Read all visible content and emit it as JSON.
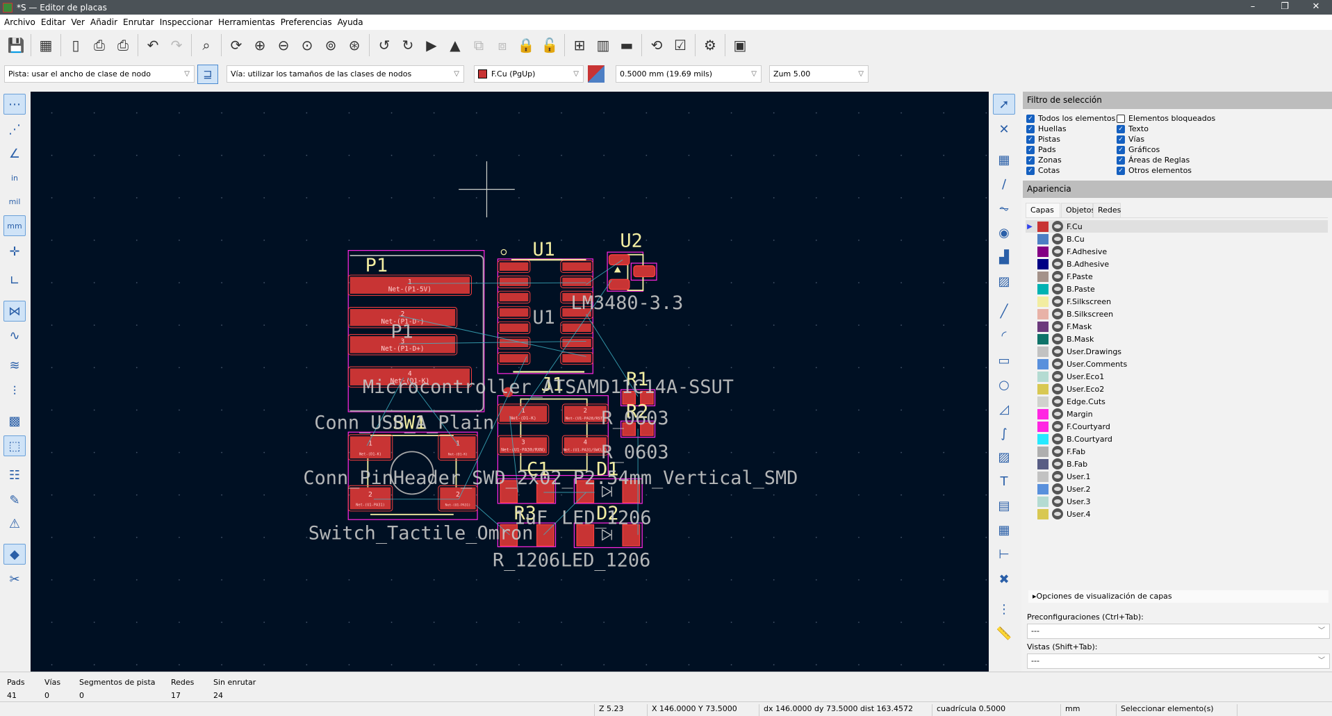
{
  "window": {
    "title": "*S — Editor de placas",
    "controls": [
      "–",
      "❐",
      "✕"
    ]
  },
  "menu": [
    "Archivo",
    "Editar",
    "Ver",
    "Añadir",
    "Enrutar",
    "Inspeccionar",
    "Herramientas",
    "Preferencias",
    "Ayuda"
  ],
  "toolbar_top": [
    [
      "save-icon"
    ],
    [
      "board-setup-icon"
    ],
    [
      "page-settings-icon",
      "print-icon",
      "plot-icon"
    ],
    [
      "undo-icon",
      "redo-icon"
    ],
    [
      "find-icon"
    ],
    [
      "refresh-icon",
      "zoom-in-icon",
      "zoom-out-icon",
      "zoom-fit-icon",
      "zoom-objects-icon",
      "zoom-selection-icon"
    ],
    [
      "rotate-ccw-icon",
      "rotate-cw-icon",
      "flip-icon",
      "mirror-icon",
      "group-icon",
      "ungroup-icon",
      "lock-icon",
      "unlock-icon"
    ],
    [
      "netlist-icon",
      "footprint-library-icon",
      "footprint-editor-icon"
    ],
    [
      "update-pcb-icon",
      "drc-icon"
    ],
    [
      "scripting-icon"
    ],
    [
      "console-icon"
    ]
  ],
  "toolbar_options": {
    "track_width": "Pista: usar el ancho de clase de nodo",
    "via_size": "Vía: utilizar los tamaños de las clases de nodos",
    "layer": "F.Cu (PgUp)",
    "layer_color": "#c83434",
    "grid": "0.5000 mm (19.69 mils)",
    "zoom": "Zum 5.00"
  },
  "left_toolbar": [
    "grid-dots-icon",
    "grid-overrides-icon",
    "polar-coords-icon",
    "inches-icon",
    "mils-icon",
    "millimeters-icon",
    "cursor-fullscreen-icon",
    "local-origin-icon",
    "ratsnest-icon",
    "curved-ratsnest-icon",
    "track-outline-icon",
    "via-outline-icon",
    "zones-fill-icon",
    "zones-outline-icon",
    "net-inspector-icon",
    "highlight-net-icon",
    "drc-marker-icon",
    "appearance-panel-icon",
    "properties-icon"
  ],
  "left_toolbar_active": [
    0,
    5,
    8,
    13,
    17
  ],
  "right_toolbar": [
    "select-icon",
    "local-ratsnest-icon",
    "add-footprint-icon",
    "route-track-icon",
    "tune-length-icon",
    "add-via-icon",
    "add-zone-icon",
    "add-rule-area-icon",
    "draw-line-icon",
    "draw-arc-icon",
    "draw-rectangle-icon",
    "draw-circle-icon",
    "draw-polygon-icon",
    "draw-bezier-icon",
    "add-image-icon",
    "add-text-icon",
    "add-textbox-icon",
    "add-table-icon",
    "add-dimension-icon",
    "delete-icon",
    "grid-origin-icon",
    "measure-icon"
  ],
  "selection_filter": {
    "title": "Filtro de selección",
    "items": [
      {
        "label": "Todos los elementos",
        "checked": true
      },
      {
        "label": "Elementos bloqueados",
        "checked": false
      },
      {
        "label": "Huellas",
        "checked": true
      },
      {
        "label": "Texto",
        "checked": true
      },
      {
        "label": "Pistas",
        "checked": true
      },
      {
        "label": "Vías",
        "checked": true
      },
      {
        "label": "Pads",
        "checked": true
      },
      {
        "label": "Gráficos",
        "checked": true
      },
      {
        "label": "Zonas",
        "checked": true
      },
      {
        "label": "Áreas de Reglas",
        "checked": true
      },
      {
        "label": "Cotas",
        "checked": true
      },
      {
        "label": "Otros elementos",
        "checked": true
      }
    ]
  },
  "appearance": {
    "title": "Apariencia",
    "tabs": [
      "Capas",
      "Objetos",
      "Redes"
    ],
    "active_tab": 0,
    "layers": [
      {
        "name": "F.Cu",
        "color": "#c83434"
      },
      {
        "name": "B.Cu",
        "color": "#4d7fc4"
      },
      {
        "name": "F.Adhesive",
        "color": "#840084"
      },
      {
        "name": "B.Adhesive",
        "color": "#000084"
      },
      {
        "name": "F.Paste",
        "color": "#a4928a"
      },
      {
        "name": "B.Paste",
        "color": "#00b2b2"
      },
      {
        "name": "F.Silkscreen",
        "color": "#f2eda1"
      },
      {
        "name": "B.Silkscreen",
        "color": "#e8b2a7"
      },
      {
        "name": "F.Mask",
        "color": "#6b3a7c"
      },
      {
        "name": "B.Mask",
        "color": "#0f7369"
      },
      {
        "name": "User.Drawings",
        "color": "#c2c2c2"
      },
      {
        "name": "User.Comments",
        "color": "#5990dc"
      },
      {
        "name": "User.Eco1",
        "color": "#b4dbd2"
      },
      {
        "name": "User.Eco2",
        "color": "#d8c852"
      },
      {
        "name": "Edge.Cuts",
        "color": "#d0d2cd"
      },
      {
        "name": "Margin",
        "color": "#ff26e2"
      },
      {
        "name": "F.Courtyard",
        "color": "#ff26e2"
      },
      {
        "name": "B.Courtyard",
        "color": "#26e9ff"
      },
      {
        "name": "F.Fab",
        "color": "#afafaf"
      },
      {
        "name": "B.Fab",
        "color": "#585d84"
      },
      {
        "name": "User.1",
        "color": "#c2c2c2"
      },
      {
        "name": "User.2",
        "color": "#5990dc"
      },
      {
        "name": "User.3",
        "color": "#b4dbd2"
      },
      {
        "name": "User.4",
        "color": "#d8c852"
      }
    ],
    "current_layer": "F.Cu",
    "layer_options": "Opciones de visualización de capas",
    "presets_label": "Preconfiguraciones (Ctrl+Tab):",
    "presets_value": "---",
    "views_label": "Vistas (Shift+Tab):",
    "views_value": "---"
  },
  "pcb": {
    "refs": {
      "P1": "P1",
      "U1": "U1",
      "U2": "U2",
      "J1": "J1",
      "R1": "R1",
      "R2": "R2",
      "SW1": "SW1",
      "C1": "C1",
      "D1": "D1",
      "R3": "R3",
      "D2": "D2"
    },
    "values": {
      "P1": "Conn_USB_A_Plain",
      "U1": "Microcontroller_ATSAMD11C14A-SSUT",
      "U2": "LM3480-3.3",
      "J1": "Conn_PinHeader_SWD_2x02_P2.54mm_Vertical_SMD",
      "R1": "R_0603",
      "R2": "R_0603",
      "SW1": "Switch_Tactile_Omron",
      "C1": "1uF",
      "D1": "LED_1206",
      "R3": "R_1206",
      "D2": "LED_1206"
    },
    "p1_pads": [
      {
        "num": "1",
        "net": "Net-(P1-5V)"
      },
      {
        "num": "2",
        "net": "Net-(P1-D-)"
      },
      {
        "num": "3",
        "net": "Net-(P1-D+)"
      },
      {
        "num": "4",
        "net": "Net-(D1-K)"
      }
    ],
    "j1_pads": [
      {
        "num": "1",
        "net": "Net-(D1-K)"
      },
      {
        "num": "2",
        "net": "Net-(U1-PA28/RST)"
      },
      {
        "num": "3",
        "net": "Net-(U1-PA30/RXN)"
      },
      {
        "num": "4",
        "net": "Net-(U1-PA31/SWCLK)"
      }
    ],
    "sw1_pads": [
      {
        "num": "1",
        "net": "Net-(D1-K)"
      },
      {
        "num": "1",
        "net": "Net-(D1-K)"
      },
      {
        "num": "2",
        "net": "Net-(U1-PA31)"
      },
      {
        "num": "2",
        "net": "Net-(U1-PA31)"
      }
    ]
  },
  "messages": {
    "headers": [
      "Pads",
      "Vías",
      "Segmentos de pista",
      "Redes",
      "Sin enrutar"
    ],
    "values": [
      "41",
      "0",
      "0",
      "17",
      "24"
    ]
  },
  "statusbar": {
    "zoom": "Z 5.23",
    "coords": "X 146.0000  Y 73.5000",
    "delta": "dx 146.0000  dy 73.5000  dist 163.4572",
    "grid": "cuadrícula 0.5000",
    "units": "mm",
    "action": "Seleccionar elemento(s)"
  }
}
